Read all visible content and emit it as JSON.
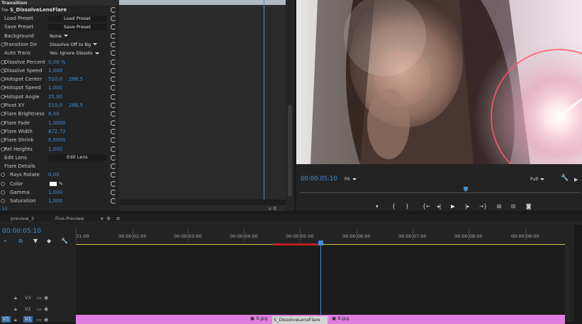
{
  "effect_controls": {
    "header": "Transition",
    "effect_name": "S_DissolveLensFlare",
    "rows": [
      {
        "label": "Load Preset",
        "button": "Load Preset"
      },
      {
        "label": "Save Preset",
        "button": "Save Preset"
      },
      {
        "label": "Background",
        "dropdown": "None"
      },
      {
        "label": "Transition Dir",
        "dropdown": "Dissolve Off to Bg"
      },
      {
        "label": "Auto Trans",
        "dropdown": "Yes: Ignore Dissolv"
      },
      {
        "label": "Dissolve Percent",
        "value": "0,00 %"
      },
      {
        "label": "Dissolve Speed",
        "value": "1,000"
      },
      {
        "label": "Hotspot Center",
        "value": "510,0",
        "value2": "286,5"
      },
      {
        "label": "Hotspot Speed",
        "value": "1,000"
      },
      {
        "label": "Hotspot Angle",
        "value": "25,00"
      },
      {
        "label": "Pivot XY",
        "value": "510,0",
        "value2": "286,5"
      },
      {
        "label": "Flare Brightness",
        "value": "8,00"
      },
      {
        "label": "Flare Fade",
        "value": "1,0000"
      },
      {
        "label": "Flare Width",
        "value": "872,72"
      },
      {
        "label": "Flare Shrink",
        "value": "0,5000"
      },
      {
        "label": "Rel Heights",
        "value": "1,000"
      },
      {
        "label": "Edit Lens",
        "button": "Edit Lens"
      },
      {
        "label": "Flare Details"
      },
      {
        "label": "Rays Rotate",
        "value": "0,00"
      },
      {
        "label": "Color",
        "value": ""
      },
      {
        "label": "Gamma",
        "value": "1,000"
      },
      {
        "label": "Saturation",
        "value": "1,000"
      }
    ],
    "footer_time": ":10"
  },
  "program_monitor": {
    "timecode": "00:00:05:10",
    "fit": "Fit",
    "quality": "Full",
    "colors": {
      "timecode": "#3f8fd8",
      "lens_flare": "#ff6a6a"
    }
  },
  "timeline": {
    "tabs": [
      "preview_3",
      "Five-Preview",
      "9"
    ],
    "timecode": "00:00:05:10",
    "ruler": [
      "01:00",
      "00:00:02:00",
      "00:00:03:00",
      "00:00:04:00",
      "00:00:05:00",
      "00:00:06:00",
      "00:00:07:00",
      "00:00:08:00",
      "00:00:09:00"
    ],
    "tracks": [
      "V3",
      "V2",
      "V1"
    ],
    "v1_left_label": "V1",
    "clips": [
      "9.jpg",
      "S_DissolveLensFlare",
      "8.jpg"
    ],
    "colors": {
      "clip": "#e07ee0",
      "playhead": "#3f8fd8",
      "work_area": "#d8c23c"
    }
  }
}
